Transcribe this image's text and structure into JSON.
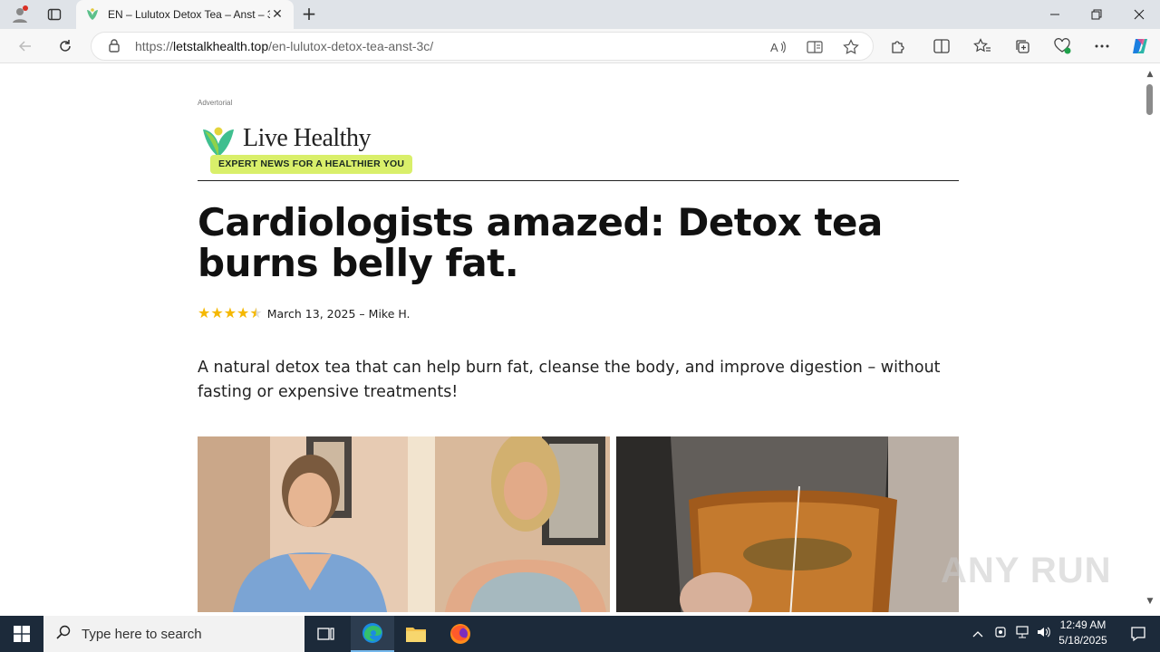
{
  "browser": {
    "tab_title": "EN – Lulutox Detox Tea – Anst – 3",
    "url_host": "letstalkhealth.top",
    "url_scheme": "https://",
    "url_path": "/en-lulutox-detox-tea-anst-3c/"
  },
  "page": {
    "advertorial_label": "Advertorial",
    "logo_name": "Live Healthy",
    "logo_tagline": "EXPERT NEWS FOR A HEALTHIER YOU",
    "headline": "Cardiologists amazed: Detox tea burns belly fat.",
    "rating": 4.5,
    "meta": "March 13, 2025 – Mike H.",
    "lede": "A natural detox tea that can help burn fat, cleanse the body, and improve digestion – without fasting or expensive treatments!"
  },
  "watermark": "ANY RUN",
  "taskbar": {
    "search_placeholder": "Type here to search",
    "time": "12:49 AM",
    "date": "5/18/2025"
  },
  "colors": {
    "accent_green": "#d9ef6a",
    "star": "#f5b800",
    "taskbar": "#1c2a3a"
  }
}
